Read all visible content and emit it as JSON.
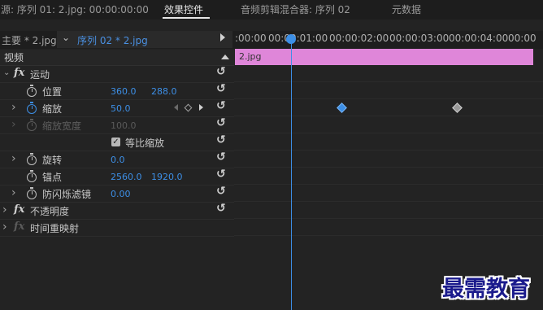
{
  "tabs": {
    "source": "源: 序列 01: 2.jpg: 00:00:00:00",
    "effects": "效果控件",
    "menu_icon": "≡",
    "audio_mixer": "音频剪辑混合器: 序列 02",
    "metadata": "元数据"
  },
  "clip_header": {
    "master": "主要 * 2.jpg",
    "sequence": "序列 02 * 2.jpg"
  },
  "timeline": {
    "timecodes": [
      ":00:00",
      "00:00:01:00",
      "00:00:02:00",
      "00:00:03:00",
      "00:00:04:00",
      "00:00"
    ],
    "clip_name": "2.jpg",
    "clip_color": "#df86d9",
    "playhead_color": "#3d8fe6"
  },
  "video_section": {
    "label": "视频"
  },
  "effects": {
    "motion": {
      "label": "运动",
      "position": {
        "label": "位置",
        "x": "360.0",
        "y": "288.0"
      },
      "scale": {
        "label": "缩放",
        "value": "50.0"
      },
      "scale_width": {
        "label": "缩放宽度",
        "value": "100.0"
      },
      "uniform_scale": {
        "label": "等比缩放",
        "checked": true
      },
      "rotation": {
        "label": "旋转",
        "value": "0.0"
      },
      "anchor": {
        "label": "锚点",
        "x": "2560.0",
        "y": "1920.0"
      },
      "antiflicker": {
        "label": "防闪烁滤镜",
        "value": "0.00"
      }
    },
    "opacity": {
      "label": "不透明度"
    },
    "time_remap": {
      "label": "时间重映射"
    }
  },
  "icons": {
    "fx": "fx",
    "reset": "↺",
    "chevron_right": "›",
    "chevron_down": "⌄",
    "check": "✓"
  },
  "watermark": "最需教育"
}
